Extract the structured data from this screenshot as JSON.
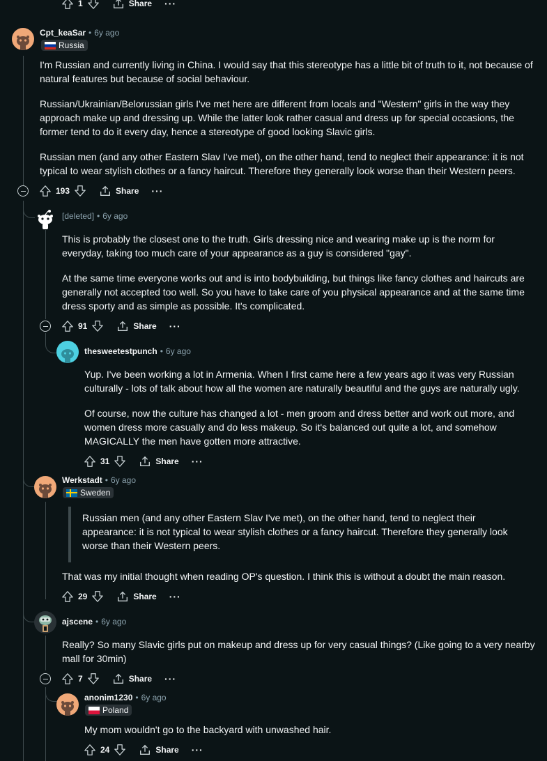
{
  "top_actions": {
    "votes": "1",
    "share": "Share",
    "more": "···"
  },
  "comments": [
    {
      "author": "Cpt_keaSar",
      "time": "6y ago",
      "flair": "Russia",
      "paragraphs": [
        "I'm Russian and currently living in China. I would say that this stereotype has a little bit of truth to it, not because of natural features but because of social behaviour.",
        "Russian/Ukrainian/Belorussian girls I've met here are different from locals and \"Western\" girls in the way they approach make up and dressing up. While the latter look rather casual and dress up for special occasions, the former tend to do it every day, hence a stereotype of good looking Slavic girls.",
        "Russian men (and any other Eastern Slav I've met), on the other hand, tend to neglect their appearance: it is not typical to wear stylish clothes or a fancy haircut. Therefore they generally look worse than their Western peers."
      ],
      "votes": "193",
      "share": "Share",
      "more": "···"
    },
    {
      "author": "[deleted]",
      "time": "6y ago",
      "paragraphs": [
        "This is probably the closest one to the truth. Girls dressing nice and wearing make up is the norm for everyday, taking too much care of your appearance as a guy is considered \"gay\".",
        "At the same time everyone works out and is into bodybuilding, but things like fancy clothes and haircuts are generally not accepted too well. So you have to take care of you physical appearance and at the same time dress sporty and as simple as possible. It's complicated."
      ],
      "votes": "91",
      "share": "Share",
      "more": "···"
    },
    {
      "author": "thesweetestpunch",
      "time": "6y ago",
      "paragraphs": [
        "Yup. I've been working a lot in Armenia. When I first came here a few years ago it was very Russian culturally - lots of talk about how all the women are naturally beautiful and the guys are naturally ugly.",
        "Of course, now the culture has changed a lot - men groom and dress better and work out more, and women dress more casually and do less makeup. So it's balanced out quite a lot, and somehow MAGICALLY the men have gotten more attractive."
      ],
      "votes": "31",
      "share": "Share",
      "more": "···"
    },
    {
      "author": "Werkstadt",
      "time": "6y ago",
      "flair": "Sweden",
      "quote": "Russian men (and any other Eastern Slav I've met), on the other hand, tend to neglect their appearance: it is not typical to wear stylish clothes or a fancy haircut. Therefore they generally look worse than their Western peers.",
      "paragraphs": [
        "That was my initial thought when reading OP's question. I think this is without a doubt the main reason."
      ],
      "votes": "29",
      "share": "Share",
      "more": "···"
    },
    {
      "author": "ajscene",
      "time": "6y ago",
      "paragraphs": [
        "Really? So many Slavic girls put on makeup and dress up for very casual things? (Like going to a very nearby mall for 30min)"
      ],
      "votes": "7",
      "share": "Share",
      "more": "···"
    },
    {
      "author": "anonim1230",
      "time": "6y ago",
      "flair": "Poland",
      "paragraphs": [
        "My mom wouldn't go to the backyard with unwashed hair."
      ],
      "votes": "24",
      "share": "Share",
      "more": "···"
    }
  ],
  "colors": {
    "background": "#0b1416",
    "text": "#f2f4f5",
    "muted": "#8ba2ad",
    "thread": "#3e4a4d",
    "avatar_orange": "#f0a878",
    "avatar_teal": "#4dd0e1"
  }
}
